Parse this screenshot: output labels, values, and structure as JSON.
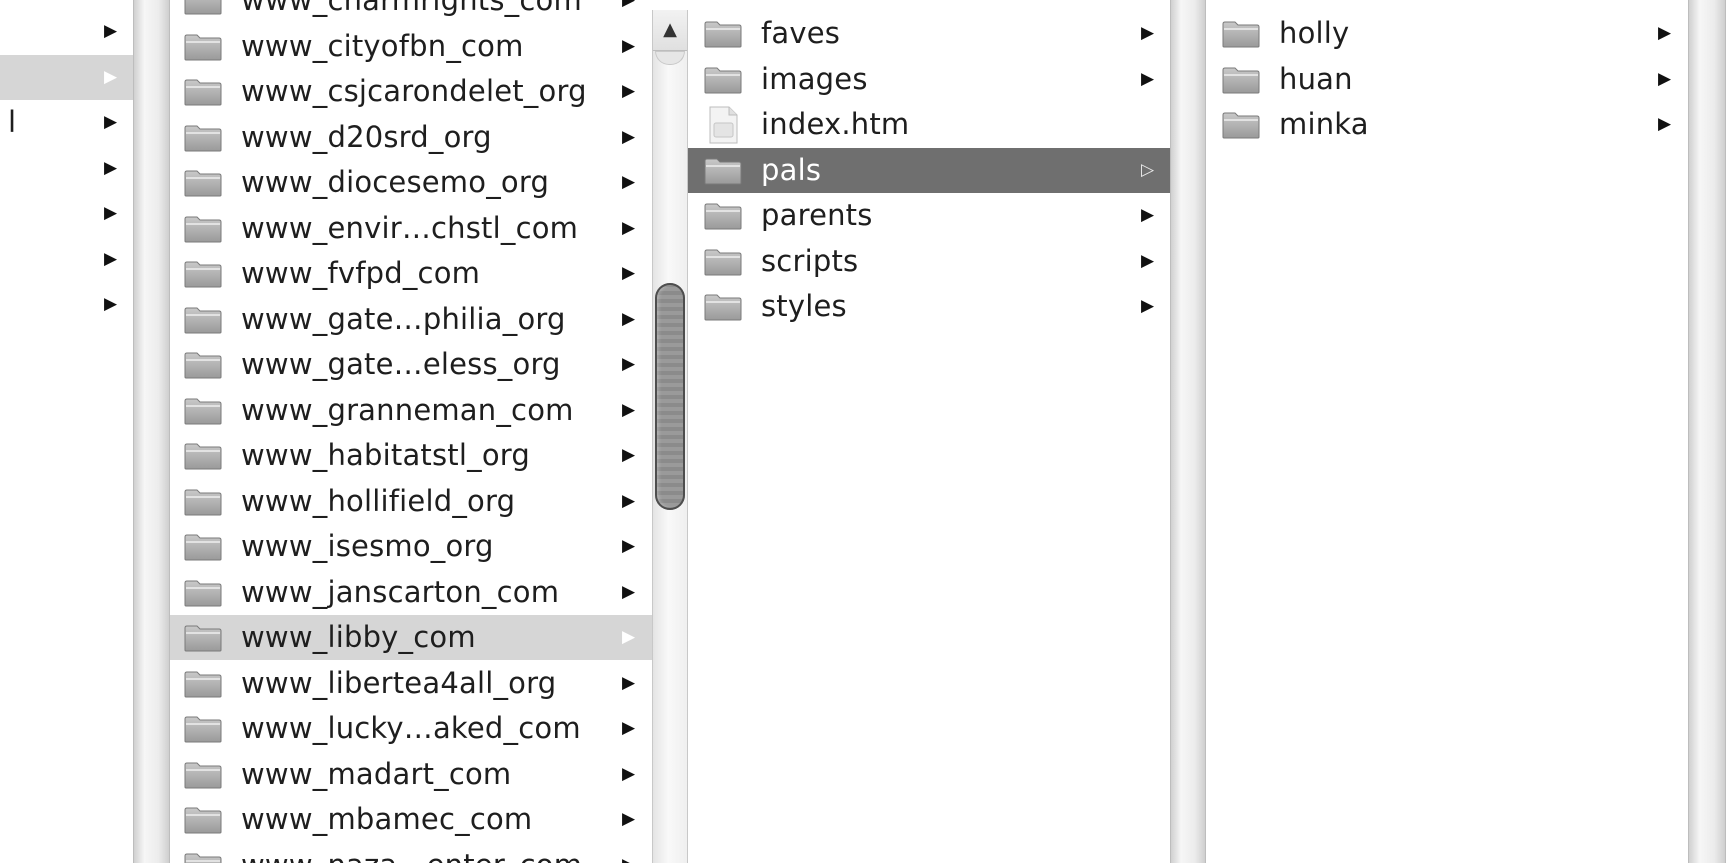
{
  "browser": {
    "column1": {
      "rows": [
        {
          "label": "",
          "has_children": true,
          "selected": false
        },
        {
          "label": "",
          "has_children": true,
          "selected": true
        },
        {
          "label": "l",
          "has_children": true,
          "selected": false
        },
        {
          "label": "",
          "has_children": true,
          "selected": false
        },
        {
          "label": "",
          "has_children": true,
          "selected": false
        },
        {
          "label": "",
          "has_children": true,
          "selected": false
        },
        {
          "label": "",
          "has_children": true,
          "selected": false
        }
      ]
    },
    "column2": {
      "rows": [
        {
          "label": "www_charmrights_com",
          "icon": "folder-icon",
          "has_children": true,
          "selected": false
        },
        {
          "label": "www_cityofbn_com",
          "icon": "folder-icon",
          "has_children": true,
          "selected": false
        },
        {
          "label": "www_csjcarondelet_org",
          "icon": "folder-icon",
          "has_children": true,
          "selected": false
        },
        {
          "label": "www_d20srd_org",
          "icon": "folder-icon",
          "has_children": true,
          "selected": false
        },
        {
          "label": "www_diocesemo_org",
          "icon": "folder-icon",
          "has_children": true,
          "selected": false
        },
        {
          "label": "www_envir…chstl_com",
          "icon": "folder-icon",
          "has_children": true,
          "selected": false
        },
        {
          "label": "www_fvfpd_com",
          "icon": "folder-icon",
          "has_children": true,
          "selected": false
        },
        {
          "label": "www_gate…philia_org",
          "icon": "folder-icon",
          "has_children": true,
          "selected": false
        },
        {
          "label": "www_gate…eless_org",
          "icon": "folder-icon",
          "has_children": true,
          "selected": false
        },
        {
          "label": "www_granneman_com",
          "icon": "folder-icon",
          "has_children": true,
          "selected": false
        },
        {
          "label": "www_habitatstl_org",
          "icon": "folder-icon",
          "has_children": true,
          "selected": false
        },
        {
          "label": "www_hollifield_org",
          "icon": "folder-icon",
          "has_children": true,
          "selected": false
        },
        {
          "label": "www_isesmo_org",
          "icon": "folder-icon",
          "has_children": true,
          "selected": false
        },
        {
          "label": "www_janscarton_com",
          "icon": "folder-icon",
          "has_children": true,
          "selected": false
        },
        {
          "label": "www_libby_com",
          "icon": "folder-icon",
          "has_children": true,
          "selected": true
        },
        {
          "label": "www_libertea4all_org",
          "icon": "folder-icon",
          "has_children": true,
          "selected": false
        },
        {
          "label": "www_lucky…aked_com",
          "icon": "folder-icon",
          "has_children": true,
          "selected": false
        },
        {
          "label": "www_madart_com",
          "icon": "folder-icon",
          "has_children": true,
          "selected": false
        },
        {
          "label": "www_mbamec_com",
          "icon": "folder-icon",
          "has_children": true,
          "selected": false
        },
        {
          "label": "www_naza…enter_com",
          "icon": "folder-icon",
          "has_children": true,
          "selected": false
        }
      ],
      "scrollbar": {
        "up_arrow": "▲",
        "thumb_position": 0.45,
        "thumb_size": 0.3
      }
    },
    "column3": {
      "rows": [
        {
          "label": "faves",
          "icon": "folder-icon",
          "has_children": true,
          "selected": false
        },
        {
          "label": "images",
          "icon": "folder-icon",
          "has_children": true,
          "selected": false
        },
        {
          "label": "index.htm",
          "icon": "html-file-icon",
          "has_children": false,
          "selected": false
        },
        {
          "label": "pals",
          "icon": "folder-icon",
          "has_children": true,
          "selected": true
        },
        {
          "label": "parents",
          "icon": "folder-icon",
          "has_children": true,
          "selected": false
        },
        {
          "label": "scripts",
          "icon": "folder-icon",
          "has_children": true,
          "selected": false
        },
        {
          "label": "styles",
          "icon": "folder-icon",
          "has_children": true,
          "selected": false
        }
      ]
    },
    "column4": {
      "rows": [
        {
          "label": "holly",
          "icon": "folder-icon",
          "has_children": true,
          "selected": false
        },
        {
          "label": "huan",
          "icon": "folder-icon",
          "has_children": true,
          "selected": false
        },
        {
          "label": "minka",
          "icon": "folder-icon",
          "has_children": true,
          "selected": false
        }
      ]
    },
    "glyphs": {
      "arrow": "▶",
      "arrow_selected": "▷"
    },
    "colors": {
      "selection_inactive": "#d6d6d6",
      "selection_active": "#6f6f6f",
      "folder": "#a8a8a8"
    }
  }
}
